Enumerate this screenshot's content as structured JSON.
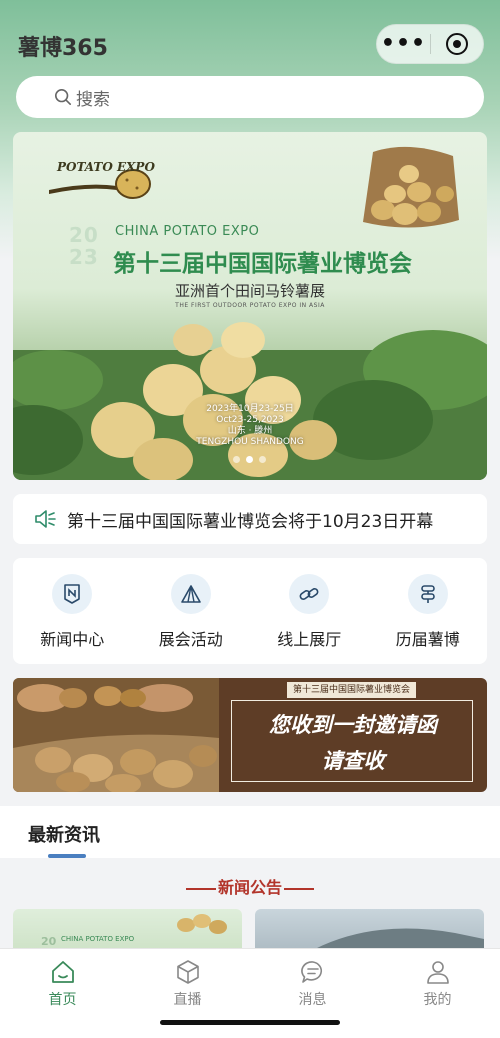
{
  "header": {
    "app_title": "薯博365",
    "more_icon": "more-dots-icon",
    "close_icon": "target-icon"
  },
  "search": {
    "placeholder": "搜索",
    "icon": "search-icon"
  },
  "banner": {
    "logo_text": "POTATO EXPO",
    "year_top": "20",
    "year_bottom": "23",
    "en_title": "CHINA POTATO EXPO",
    "cn_title": "第十三届中国国际薯业博览会",
    "subtitle": "亚洲首个田间马铃薯展",
    "subtitle_en": "THE FIRST OUTDOOR POTATO EXPO IN ASIA",
    "date_cn": "2023年10月23-25日",
    "date_en": "Oct23-25,2023",
    "location_cn": "山东 · 滕州",
    "location_en": "TENGZHOU SHANDONG",
    "slide_count": 3,
    "active_slide": 1
  },
  "notice": {
    "icon": "speaker-icon",
    "text": "第十三届中国国际薯业博览会将于10月23日开幕"
  },
  "quick_links": [
    {
      "label": "新闻中心",
      "icon": "news-icon"
    },
    {
      "label": "展会活动",
      "icon": "tent-icon"
    },
    {
      "label": "线上展厅",
      "icon": "link-icon"
    },
    {
      "label": "历届薯博",
      "icon": "signpost-icon"
    }
  ],
  "invite_banner": {
    "tag": "第十三届中国国际薯业博览会",
    "line1": "您收到一封邀请函",
    "line2": "请查收"
  },
  "news": {
    "section_title": "最新资讯",
    "category_title": "新闻公告",
    "card1_year": "20",
    "card1_en": "CHINA POTATO EXPO"
  },
  "tabbar": [
    {
      "label": "首页",
      "icon": "home-icon",
      "active": true
    },
    {
      "label": "直播",
      "icon": "live-cube-icon",
      "active": false
    },
    {
      "label": "消息",
      "icon": "message-icon",
      "active": false
    },
    {
      "label": "我的",
      "icon": "user-icon",
      "active": false
    }
  ],
  "colors": {
    "accent_green": "#3a8a5a",
    "title_green": "#2f8c4f",
    "section_red": "#b2342a",
    "invite_brown": "#5e3d26",
    "underline_blue": "#4a7fc0"
  }
}
